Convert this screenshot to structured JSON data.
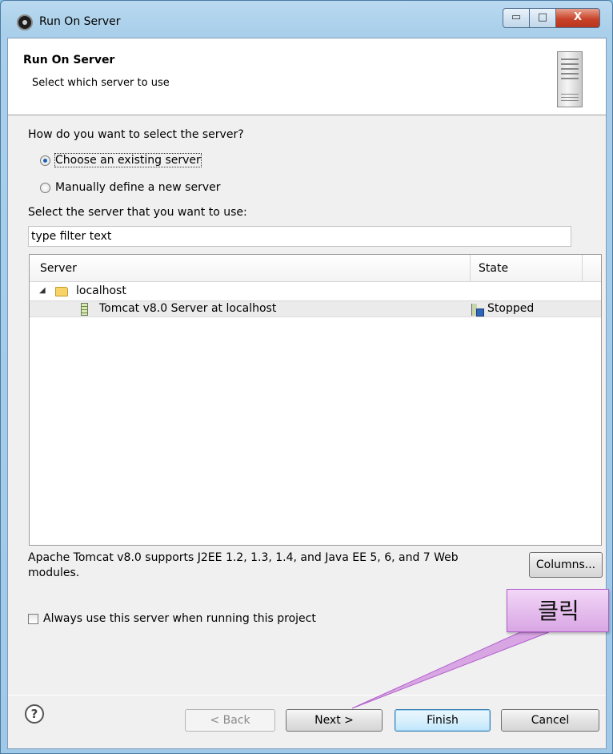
{
  "window": {
    "title": "Run On Server",
    "min_glyph": "▭",
    "max_glyph": "□",
    "close_glyph": "X"
  },
  "header": {
    "title": "Run On Server",
    "description": "Select which server to use"
  },
  "selection": {
    "question": "How do you want to select the server?",
    "option_existing": "Choose an existing server",
    "option_new": "Manually define a new server",
    "selected": "existing"
  },
  "filter": {
    "label": "Select the server that you want to use:",
    "value": "type filter text"
  },
  "table": {
    "columns": [
      "Server",
      "State"
    ],
    "rows": [
      {
        "type": "host",
        "label": "localhost",
        "expanded": true
      },
      {
        "type": "server",
        "label": "Tomcat v8.0 Server at localhost",
        "state": "Stopped",
        "selected": true
      }
    ]
  },
  "description": "Apache Tomcat v8.0 supports J2EE 1.2, 1.3, 1.4, and Java EE 5, 6, and 7 Web modules.",
  "buttons": {
    "columns": "Columns...",
    "back": "< Back",
    "next": "Next >",
    "finish": "Finish",
    "cancel": "Cancel"
  },
  "always_use": {
    "label": "Always use this server when running this project",
    "checked": false
  },
  "callout": {
    "text": "클릭",
    "color": "#d9a6e4"
  },
  "icons": {
    "help": "?"
  }
}
